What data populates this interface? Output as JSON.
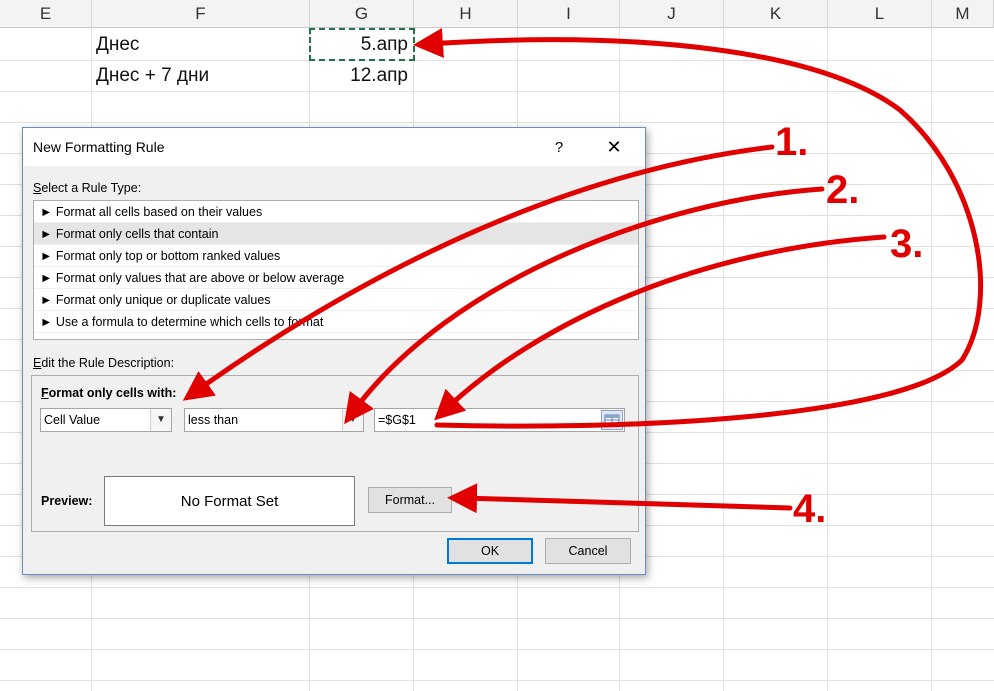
{
  "spreadsheet": {
    "column_headers": [
      "E",
      "F",
      "G",
      "H",
      "I",
      "J",
      "K",
      "L",
      "M"
    ],
    "cells": {
      "f1": "Днес",
      "g1": "5.апр",
      "f2": "Днес + 7 дни",
      "g2": "12.апр"
    }
  },
  "dialog": {
    "title": "New Formatting Rule",
    "help": "?",
    "close": "✕",
    "rule_type_label_prefix": "S",
    "rule_type_label_rest": "elect a Rule Type:",
    "rule_types": [
      "► Format all cells based on their values",
      "► Format only cells that contain",
      "► Format only top or bottom ranked values",
      "► Format only values that are above or below average",
      "► Format only unique or duplicate values",
      "► Use a formula to determine which cells to format"
    ],
    "selected_rule_index": 1,
    "edit_desc_prefix": "E",
    "edit_desc_rest": "dit the Rule Description:",
    "format_only_with_prefix": "F",
    "format_only_with_rest": "ormat only cells with:",
    "cell_value_combo": "Cell Value",
    "operator_combo": "less than",
    "value_field": "=$G$1",
    "preview_label": "Preview:",
    "preview_text": "No Format Set",
    "format_button": "Format...",
    "ok_button": "OK",
    "cancel_button": "Cancel"
  },
  "annotations": {
    "labels": [
      "1.",
      "2.",
      "3.",
      "4."
    ],
    "color": "#e00000"
  }
}
